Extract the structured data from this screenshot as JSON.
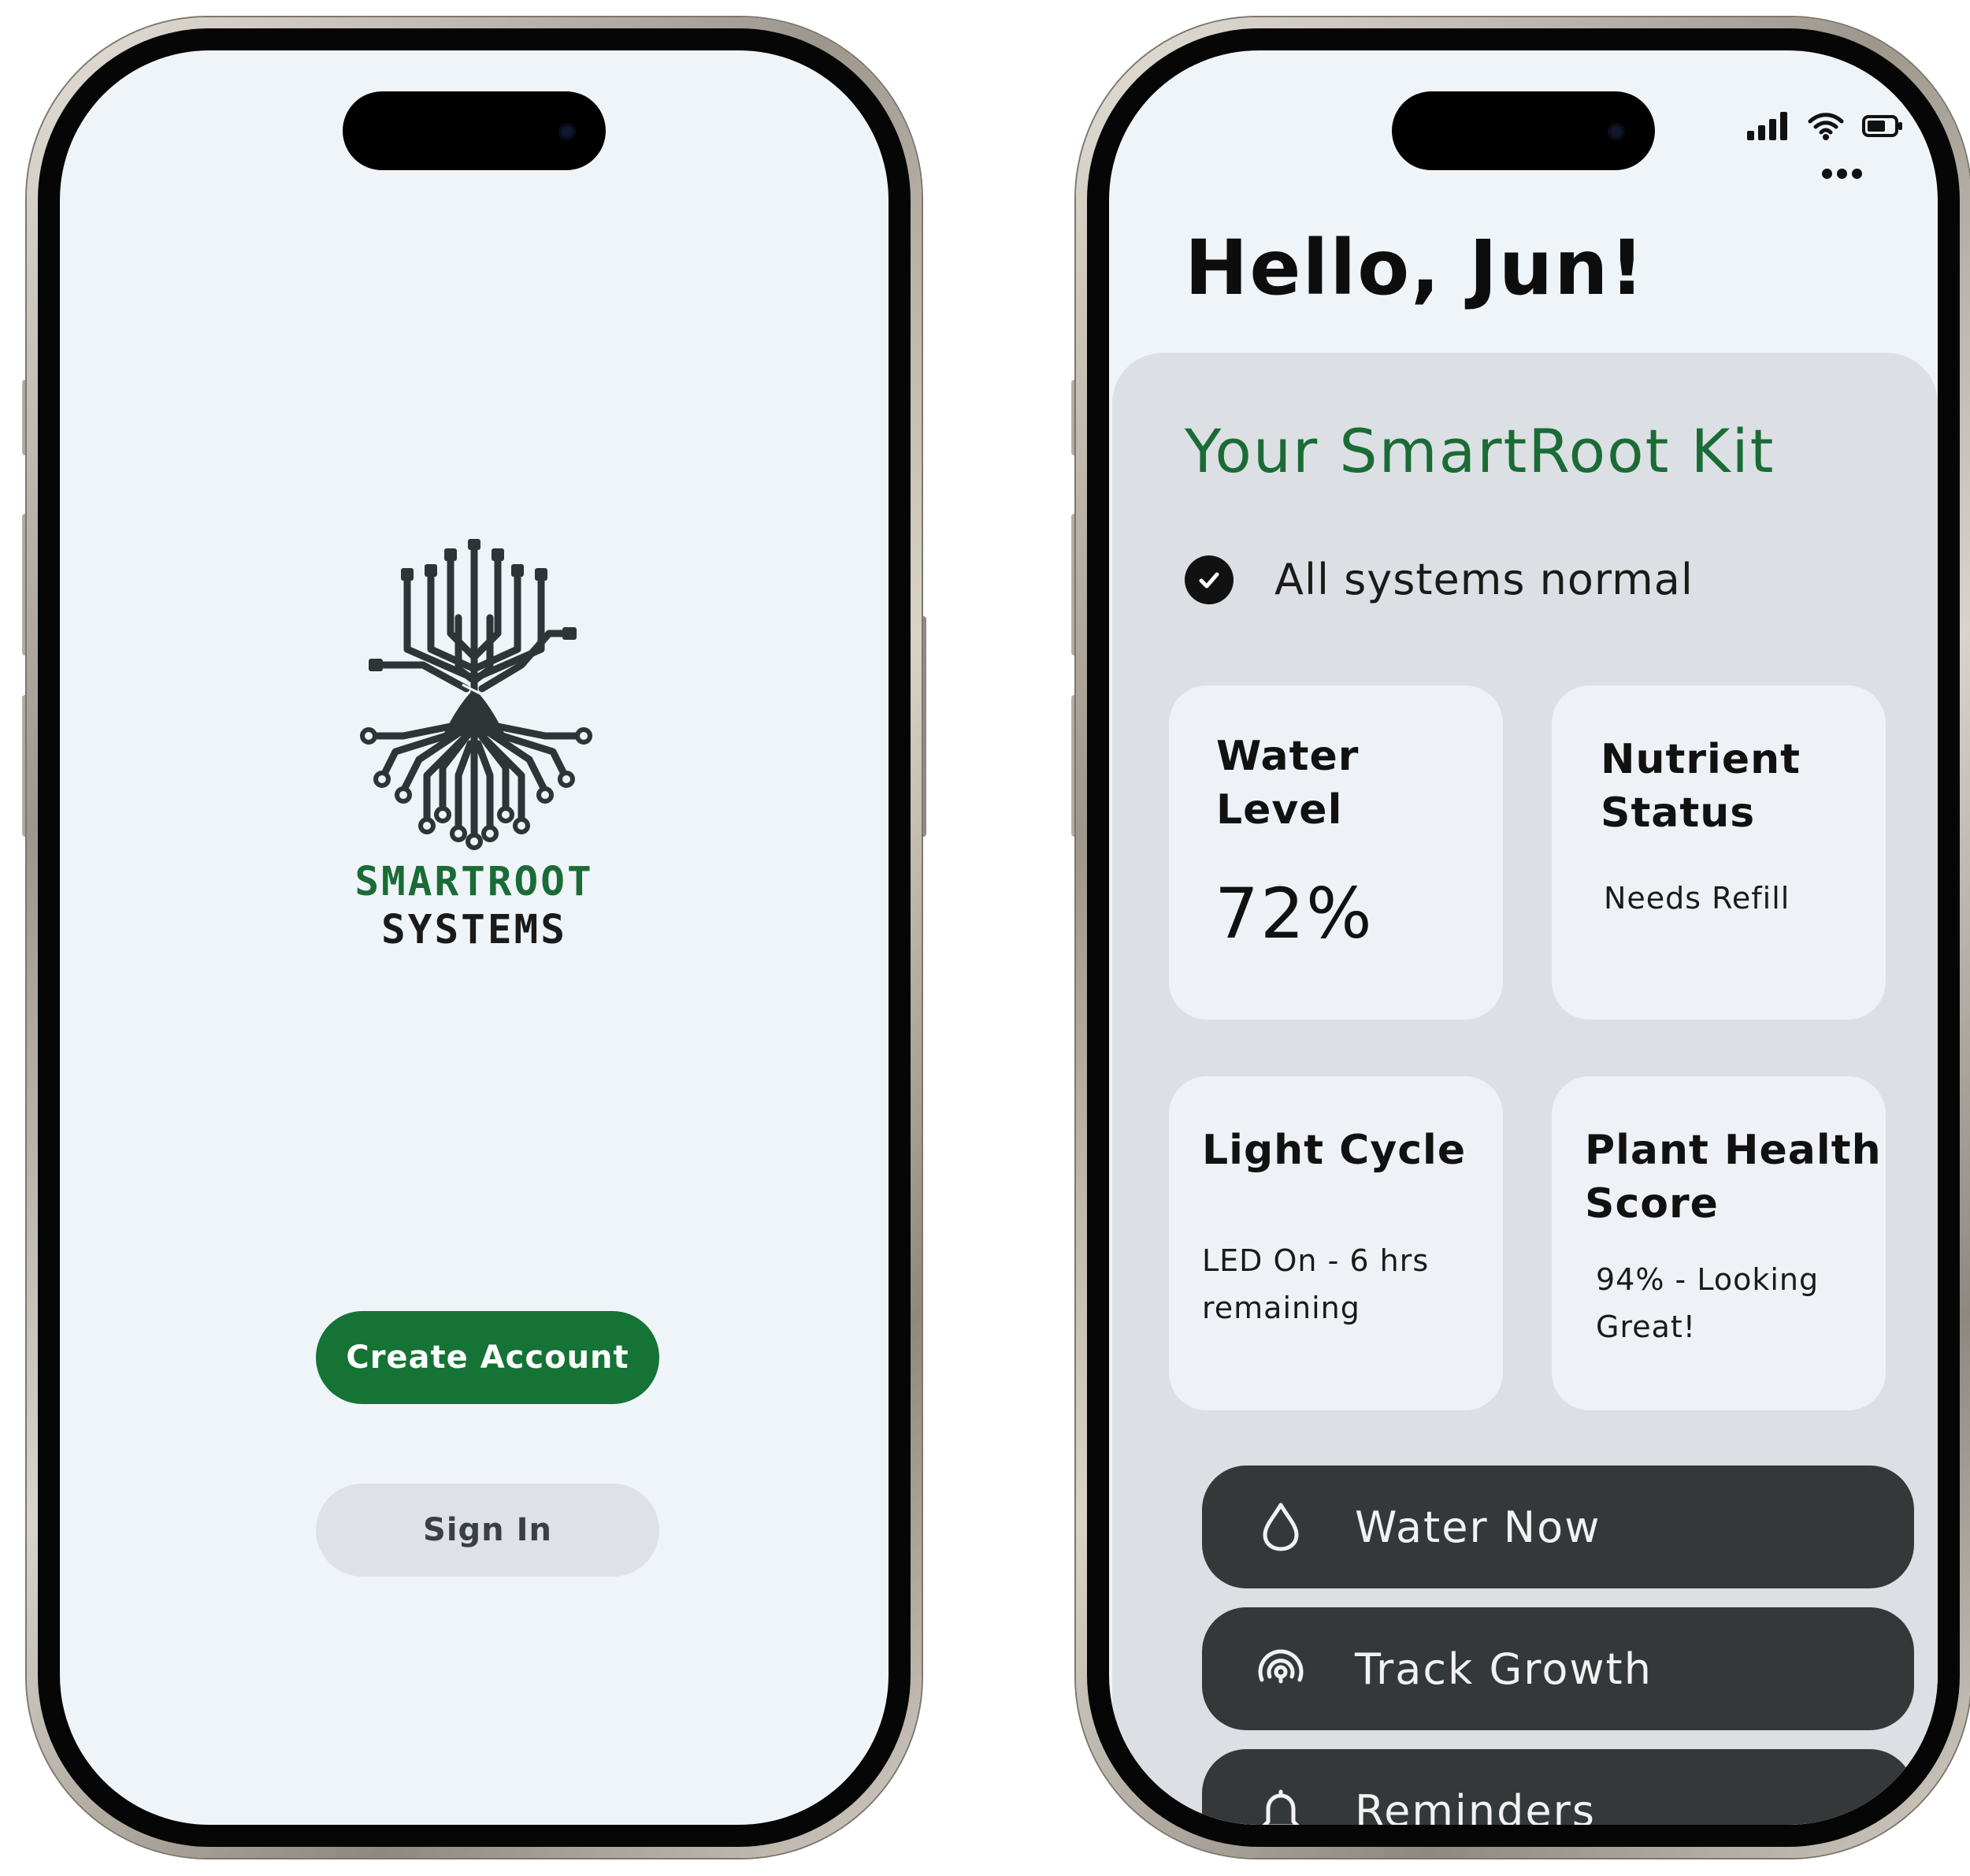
{
  "colors": {
    "brand_green": "#157335",
    "title_green": "#1a6b35",
    "screen_bg": "#eff4f9",
    "panel_bg": "#dce0e4",
    "card_bg": "#eef2f6",
    "action_bg": "#343839",
    "secondary_button_bg": "#dee2e7"
  },
  "welcome_screen": {
    "logo_icon": "circuit-tree-icon",
    "brand_line1": "SMARTROOT",
    "brand_line2": "SYSTEMS",
    "create_account_label": "Create Account",
    "sign_in_label": "Sign In"
  },
  "dashboard_screen": {
    "status_bar": {
      "icons": [
        "cellular-signal-icon",
        "wifi-icon",
        "battery-icon"
      ]
    },
    "menu_icon": "more-options-icon",
    "greeting": "Hello, Jun!",
    "kit_title": "Your SmartRoot Kit",
    "system_status": {
      "icon": "check-circle-icon",
      "text": "All systems normal"
    },
    "cards": {
      "water_level": {
        "title_line1": "Water",
        "title_line2": "Level",
        "value": "72%"
      },
      "nutrient_status": {
        "title_line1": "Nutrient",
        "title_line2": "Status",
        "detail": "Needs Refill"
      },
      "light_cycle": {
        "title": "Light Cycle",
        "detail_line1": "LED On - 6 hrs",
        "detail_line2": "remaining"
      },
      "plant_health": {
        "title_line1": "Plant Health",
        "title_line2": "Score",
        "detail_line1": "94% - Looking",
        "detail_line2": "Great!"
      }
    },
    "actions": [
      {
        "label": "Water Now",
        "icon": "water-drop-icon"
      },
      {
        "label": "Track Growth",
        "icon": "radar-signal-icon"
      },
      {
        "label": "Reminders",
        "icon": "bell-icon"
      }
    ]
  }
}
